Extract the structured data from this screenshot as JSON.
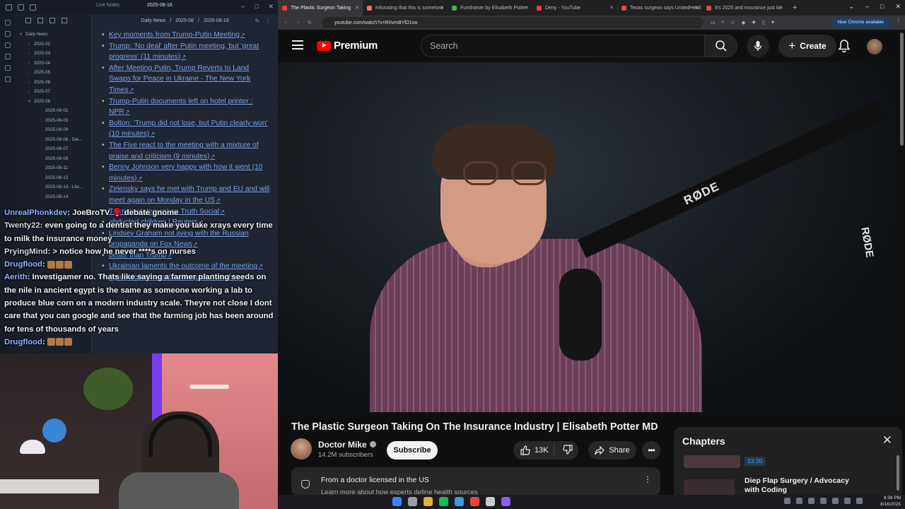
{
  "notes_app": {
    "title_tab_1": "Live Notes",
    "title_tab_2": "2025-08-16",
    "breadcrumb": [
      "Daily News",
      "2025-08",
      "2025-08-16"
    ],
    "tree": [
      {
        "label": "Daily News",
        "level": 0,
        "caret": "▾"
      },
      {
        "label": "2025-02",
        "level": 1,
        "caret": "›"
      },
      {
        "label": "2025-03",
        "level": 1,
        "caret": "›"
      },
      {
        "label": "2025-04",
        "level": 1,
        "caret": "›"
      },
      {
        "label": "2025-05",
        "level": 1,
        "caret": "›"
      },
      {
        "label": "2025-06",
        "level": 1,
        "caret": "›"
      },
      {
        "label": "2025-07",
        "level": 1,
        "caret": "›"
      },
      {
        "label": "2025-08",
        "level": 1,
        "caret": "▾"
      },
      {
        "label": "2025-08-01",
        "level": 2,
        "caret": ""
      },
      {
        "label": "2025-08-03",
        "level": 2,
        "caret": ""
      },
      {
        "label": "2025-08-04",
        "level": 2,
        "caret": ""
      },
      {
        "label": "2025-08-06 - Die...",
        "level": 2,
        "caret": ""
      },
      {
        "label": "2025-08-07",
        "level": 2,
        "caret": ""
      },
      {
        "label": "2025-08-08",
        "level": 2,
        "caret": ""
      },
      {
        "label": "2025-08-11",
        "level": 2,
        "caret": ""
      },
      {
        "label": "2025-08-12",
        "level": 2,
        "caret": ""
      },
      {
        "label": "2025-08-13 - Lite...",
        "level": 2,
        "caret": ""
      },
      {
        "label": "2025-08-14",
        "level": 2,
        "caret": ""
      }
    ],
    "links": [
      "Key moments from Trump-Putin Meeting",
      "Trump: 'No deal' after Putin meeting, but 'great progress' (11 minutes)",
      "After Meeting Putin, Trump Reverts to Land Swaps for Peace in Ukraine - The New York Times",
      "Trump-Putin documents left on hotel printer : NPR",
      "Bolton: 'Trump did not lose, but Putin clearly won' (10 minutes)",
      "The Five react to the meeting with a mixture of praise and criticism (9 minutes)",
      "Benny Johnson very happy with how it went (10 minutes)",
      "Zelensky says he met with Trump and EU and will meet again on Monday in the US",
      "Trump's statement on Truth Social",
      "abducted children | Reuters",
      "Lindsey Graham not jiving with the Russian propaganda on Fox News",
      "better than Trump",
      "Ukrainian laments the outcome of the meeting",
      "Ryan McBeth reacts with quick thoughts"
    ]
  },
  "chat": [
    {
      "user": "UnrealPhonkdev",
      "text": "JoeBroTV 🥊 debate gnome",
      "user_color": "#8fb2ff"
    },
    {
      "user": "Twenty22",
      "text": "even going to a dentist they make you take xrays every time to milk the insurance money",
      "user_color": "#d7d7d7"
    },
    {
      "user": "PryingMind",
      "text": "> notice how he never ****s on nurses",
      "user_color": "#d7d7d7"
    },
    {
      "user": "Drugflood",
      "text": "",
      "user_color": "#8fb2ff"
    },
    {
      "user": "Aerith",
      "text": "Investigamer no. Thats like saying a farmer planting seeds on the nile in ancient egypt is the same as someone working a lab to produce blue corn on a modern industry scale. Theyre not close I dont care that you can google and see that the farming job has been around for tens of thousands of years",
      "user_color": "#8fb2ff"
    },
    {
      "user": "Drugflood",
      "text": "",
      "user_color": "#8fb2ff"
    }
  ],
  "browser": {
    "tabs": [
      {
        "label": "The Plastic Surgeon Taking",
        "active": true,
        "favicon": "#ff3b3b"
      },
      {
        "label": "Infuriating that this is somehow",
        "active": false,
        "favicon": "#ff6b6b"
      },
      {
        "label": "Fundraiser by Elisabeth Potter",
        "active": false,
        "favicon": "#4caf50"
      },
      {
        "label": "Deny - YouTube",
        "active": false,
        "favicon": "#ff3b3b"
      },
      {
        "label": "Texas surgeon says UnitedHealt",
        "active": false,
        "favicon": "#e04848"
      },
      {
        "label": "It's 2025 and insurance just ke",
        "active": false,
        "favicon": "#e04848"
      }
    ],
    "url": "youtube.com/watch?v=R0vmBYlD1oo",
    "new_chrome": "New Chrome available"
  },
  "youtube": {
    "logo": "Premium",
    "search_placeholder": "Search",
    "create_label": "Create",
    "video_title": "The Plastic Surgeon Taking On The Insurance Industry | Elisabeth Potter MD",
    "channel": "Doctor Mike",
    "subscribers": "14.2M subscribers",
    "subscribe_label": "Subscribe",
    "likes": "13K",
    "share_label": "Share",
    "info_title": "From a doctor licensed in the US",
    "info_sub": "Learn more about how experts define health sources",
    "video_brand_1": "RØDE",
    "video_brand_2": "RØDE"
  },
  "chapters": {
    "title": "Chapters",
    "items": [
      {
        "time": "13:20",
        "name": ""
      },
      {
        "time": "",
        "name": "Diep Flap Surgery / Advocacy with Coding"
      }
    ]
  },
  "taskbar": {
    "time": "8:39 PM",
    "date": "8/16/2025",
    "app_colors": [
      "#3b82f6",
      "#9aa0a6",
      "#e0b341",
      "#1db954",
      "#3a9bdc",
      "#ea4335",
      "#cccccc",
      "#8b5cf6"
    ]
  }
}
